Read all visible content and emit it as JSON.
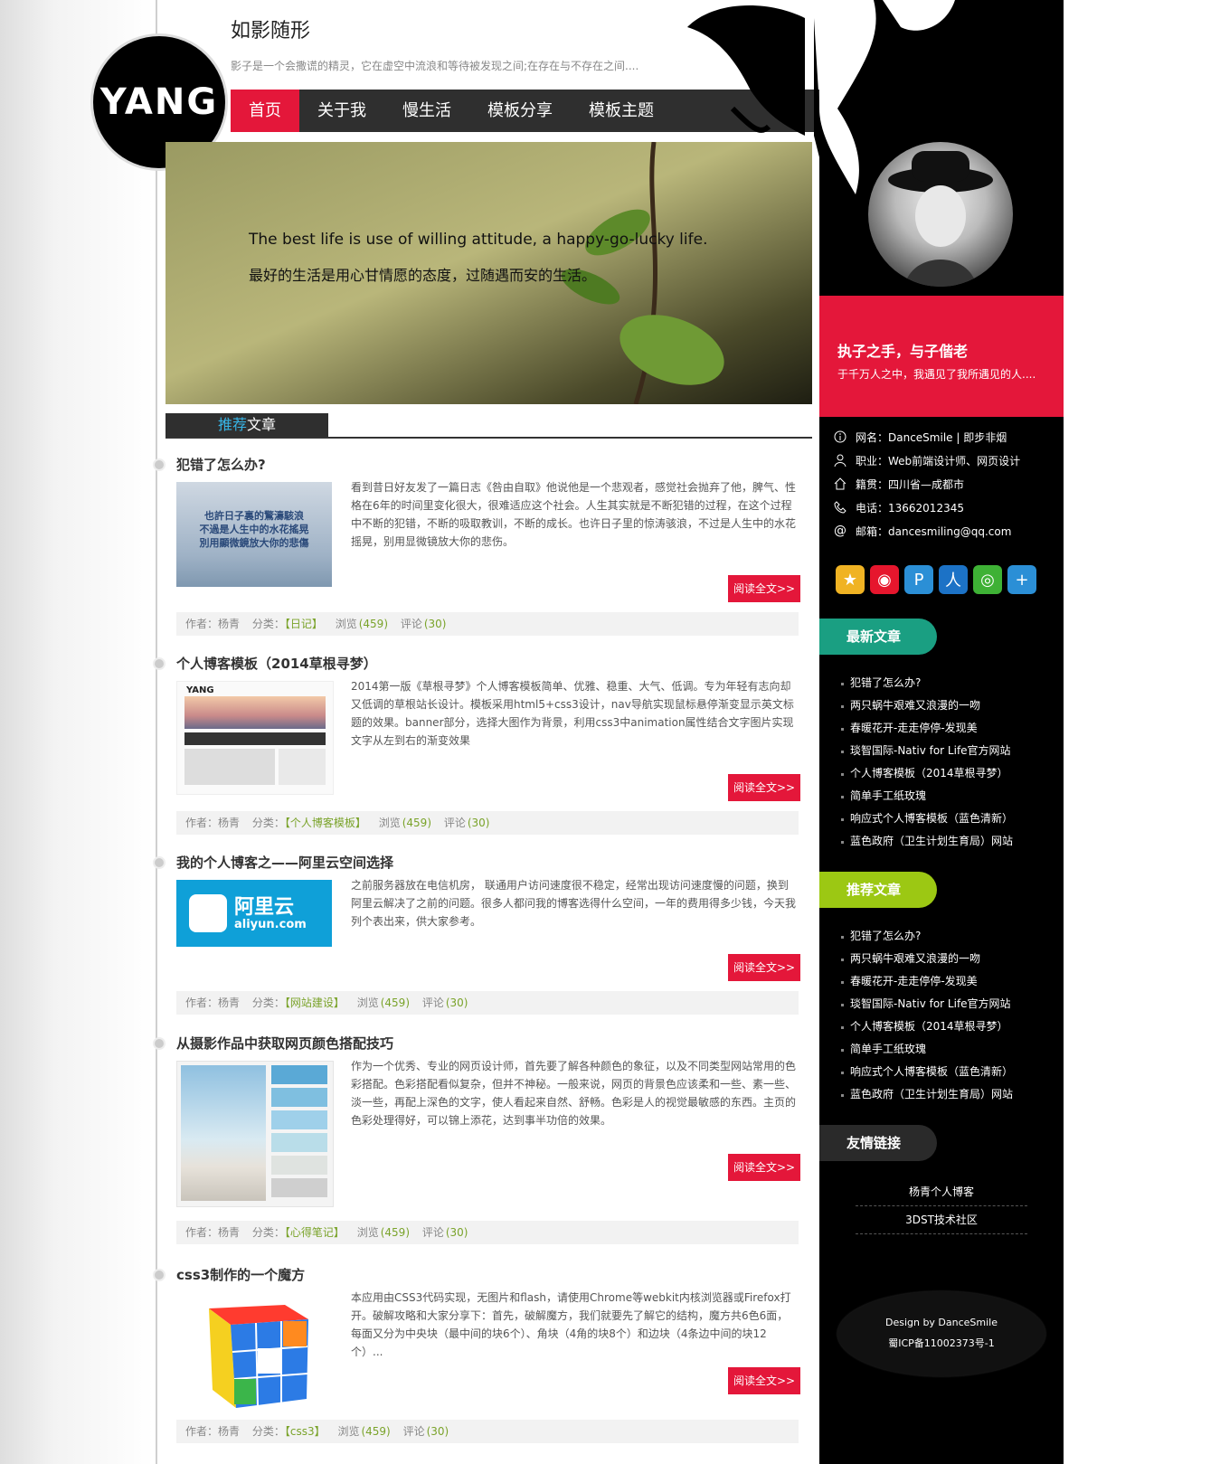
{
  "site": {
    "logo_text": "YANG",
    "title": "如影随形",
    "description": "影子是一个会撒谎的精灵，它在虚空中流浪和等待被发现之间;在存在与不存在之间...."
  },
  "nav": {
    "items": [
      "首页",
      "关于我",
      "慢生活",
      "模板分享",
      "模板主题"
    ]
  },
  "banner": {
    "en": "The best life is use of willing attitude, a happy-go-lucky life.",
    "cn": "最好的生活是用心甘情愿的态度，过随遇而安的生活。"
  },
  "section": {
    "title_hl": "推荐",
    "title_rest": "文章"
  },
  "article_labels": {
    "read_more": "阅读全文>>",
    "author_label": "作者：",
    "category_label": "分类：",
    "views_label": "浏览",
    "comments_label": "评论"
  },
  "articles": [
    {
      "title": "犯错了怎么办?",
      "thumb_text": "也許日子裏的驚濤駭浪\n不過是人生中的水花搖晃\n別用顯微鏡放大你的悲傷",
      "summary": "看到昔日好友发了一篇日志《咎由自取》他说他是一个悲观者，感觉社会抛弃了他，脾气、性格在6年的时间里变化很大，很难适应这个社会。人生其实就是不断犯错的过程，在这个过程中不断的犯错，不断的吸取教训，不断的成长。也许日子里的惊涛骇浪，不过是人生中的水花摇晃，别用显微镜放大你的悲伤。",
      "author": "杨青",
      "category": "【日记】",
      "views": "(459)",
      "comments": "(30)"
    },
    {
      "title": "个人博客模板（2014草根寻梦）",
      "thumb_text": "YANG",
      "summary": "2014第一版《草根寻梦》个人博客模板简单、优雅、稳重、大气、低调。专为年轻有志向却又低调的草根站长设计。模板采用html5+css3设计，nav导航实现鼠标悬停渐变显示英文标题的效果。banner部分，选择大图作为背景，利用css3中animation属性结合文字图片实现文字从左到右的渐变效果",
      "author": "杨青",
      "category": "【个人博客模板】",
      "views": "(459)",
      "comments": "(30)"
    },
    {
      "title": "我的个人博客之——阿里云空间选择",
      "thumb_text": "阿里云",
      "thumb_sub": "aliyun.com",
      "summary": "之前服务器放在电信机房， 联通用户访问速度很不稳定，经常出现访问速度慢的问题，换到阿里云解决了之前的问题。很多人都问我的博客选得什么空间，一年的费用得多少钱，今天我列个表出来，供大家参考。",
      "author": "杨青",
      "category": "【网站建设】",
      "views": "(459)",
      "comments": "(30)"
    },
    {
      "title": "从摄影作品中获取网页颜色搭配技巧",
      "summary": "作为一个优秀、专业的网页设计师，首先要了解各种颜色的象征，以及不同类型网站常用的色彩搭配。色彩搭配看似复杂，但并不神秘。一般来说，网页的背景色应该柔和一些、素一些、淡一些，再配上深色的文字，使人看起来自然、舒畅。色彩是人的视觉最敏感的东西。主页的色彩处理得好，可以锦上添花，达到事半功倍的效果。",
      "author": "杨青",
      "category": "【心得笔记】",
      "views": "(459)",
      "comments": "(30)",
      "swatches": [
        "#5aa9d6",
        "#7fbfe0",
        "#9fd0ea",
        "#b9dde9",
        "#dfe3e0",
        "#cfcfcf"
      ]
    },
    {
      "title": "css3制作的一个魔方",
      "summary": "本应用由CSS3代码实现，无图片和flash，请使用Chrome等webkit内核浏览器或Firefox打开。破解攻略和大家分享下：首先，破解魔方，我们就要先了解它的结构，魔方共6色6面，每面又分为中央块（最中间的块6个）、角块（4角的块8个）和边块（4条边中间的块12个）...",
      "author": "杨青",
      "category": "【css3】",
      "views": "(459)",
      "comments": "(30)"
    }
  ],
  "profile": {
    "motto": "执子之手，与子偕老",
    "motto_sub": "于千万人之中，我遇见了我所遇见的人....",
    "rows": [
      {
        "icon": "info-icon",
        "text": "网名：DanceSmile | 即步非烟"
      },
      {
        "icon": "user-icon",
        "text": "职业：Web前端设计师、网页设计"
      },
      {
        "icon": "home-icon",
        "text": "籍贯：四川省—成都市"
      },
      {
        "icon": "phone-icon",
        "text": "电话：13662012345"
      },
      {
        "icon": "at-icon",
        "text": "邮箱：dancesmiling@qq.com"
      }
    ]
  },
  "socials": [
    {
      "name": "qzone-icon",
      "color": "#f0b323",
      "glyph": "★"
    },
    {
      "name": "weibo-icon",
      "color": "#e6162d",
      "glyph": "◉"
    },
    {
      "name": "tencent-weibo-icon",
      "color": "#2b8fd6",
      "glyph": "P"
    },
    {
      "name": "renren-icon",
      "color": "#1c72c6",
      "glyph": "人"
    },
    {
      "name": "wechat-icon",
      "color": "#3eb135",
      "glyph": "◎"
    },
    {
      "name": "more-icon",
      "color": "#2b8fd6",
      "glyph": "+"
    }
  ],
  "sidebar": {
    "latest_title": "最新文章",
    "latest_color": "#1a9f82",
    "latest": [
      "犯错了怎么办?",
      "两只蜗牛艰难又浪漫的一吻",
      "春暖花开-走走停停-发现美",
      "琰智国际-Nativ for Life官方网站",
      "个人博客模板（2014草根寻梦）",
      "简单手工纸玫瑰",
      "响应式个人博客模板（蓝色清新）",
      "蓝色政府（卫生计划生育局）网站"
    ],
    "recommend_title": "推荐文章",
    "recommend_color": "#9cc813",
    "recommend": [
      "犯错了怎么办?",
      "两只蜗牛艰难又浪漫的一吻",
      "春暖花开-走走停停-发现美",
      "琰智国际-Nativ for Life官方网站",
      "个人博客模板（2014草根寻梦）",
      "简单手工纸玫瑰",
      "响应式个人博客模板（蓝色清新）",
      "蓝色政府（卫生计划生育局）网站"
    ],
    "links_title": "友情链接",
    "links_color": "#2a2a2a",
    "links": [
      "杨青个人博客",
      "3DST技术社区"
    ]
  },
  "footer": {
    "design": "Design by DanceSmile",
    "icp": "蜀ICP备11002373号-1"
  },
  "colors": {
    "accent_red": "#e4173a",
    "nav_bg": "#2f2f2f",
    "hl_blue": "#37b4e6",
    "meta_green": "#7aa32a"
  }
}
